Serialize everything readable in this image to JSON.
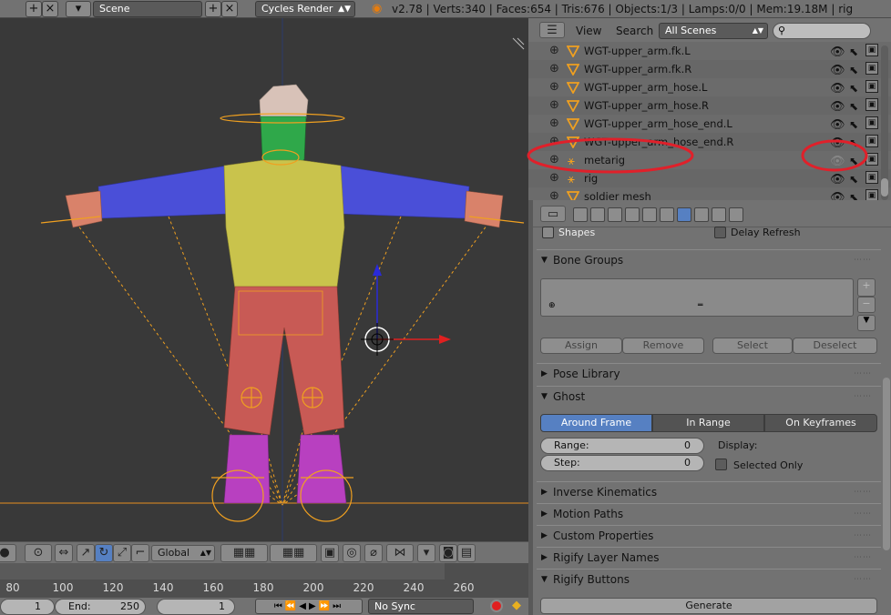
{
  "topbar": {
    "scene": "Scene",
    "render_engine": "Cycles Render",
    "stats": "v2.78 | Verts:340 | Faces:654 | Tris:676 | Objects:1/3 | Lamps:0/0 | Mem:19.18M | rig"
  },
  "outliner": {
    "menu_view": "View",
    "menu_search": "Search",
    "scene_filter": "All Scenes",
    "rows": [
      {
        "label": "WGT-upper_arm.fk.L"
      },
      {
        "label": "WGT-upper_arm.fk.R"
      },
      {
        "label": "WGT-upper_arm_hose.L"
      },
      {
        "label": "WGT-upper_arm_hose.R"
      },
      {
        "label": "WGT-upper_arm_hose_end.L"
      },
      {
        "label": "WGT-upper_arm_hose_end.R"
      },
      {
        "label": "metarig"
      },
      {
        "label": "rig"
      },
      {
        "label": "soldier mesh"
      }
    ]
  },
  "properties": {
    "shapes": "Shapes",
    "delay_refresh": "Delay Refresh",
    "bone_groups": "Bone Groups",
    "assign": "Assign",
    "remove": "Remove",
    "select": "Select",
    "deselect": "Deselect",
    "pose_library": "Pose Library",
    "ghost": "Ghost",
    "ghost_modes": [
      "Around Frame",
      "In Range",
      "On Keyframes"
    ],
    "range_label": "Range:",
    "range_value": "0",
    "step_label": "Step:",
    "step_value": "0",
    "display_label": "Display:",
    "selected_only": "Selected Only",
    "panels": [
      "Inverse Kinematics",
      "Motion Paths",
      "Custom Properties",
      "Rigify Layer Names",
      "Rigify Buttons"
    ],
    "generate": "Generate"
  },
  "view3d": {
    "orientation": "Global"
  },
  "timeline": {
    "ticks": [
      "80",
      "100",
      "120",
      "140",
      "160",
      "180",
      "200",
      "220",
      "240",
      "260"
    ],
    "start_value": "1",
    "end_label": "End:",
    "end_value": "250",
    "current_frame": "1",
    "sync": "No Sync"
  },
  "colors": {
    "accent_blue": "#5680c2",
    "annotation_red": "#e0202a",
    "armature_orange": "#f0a020"
  }
}
